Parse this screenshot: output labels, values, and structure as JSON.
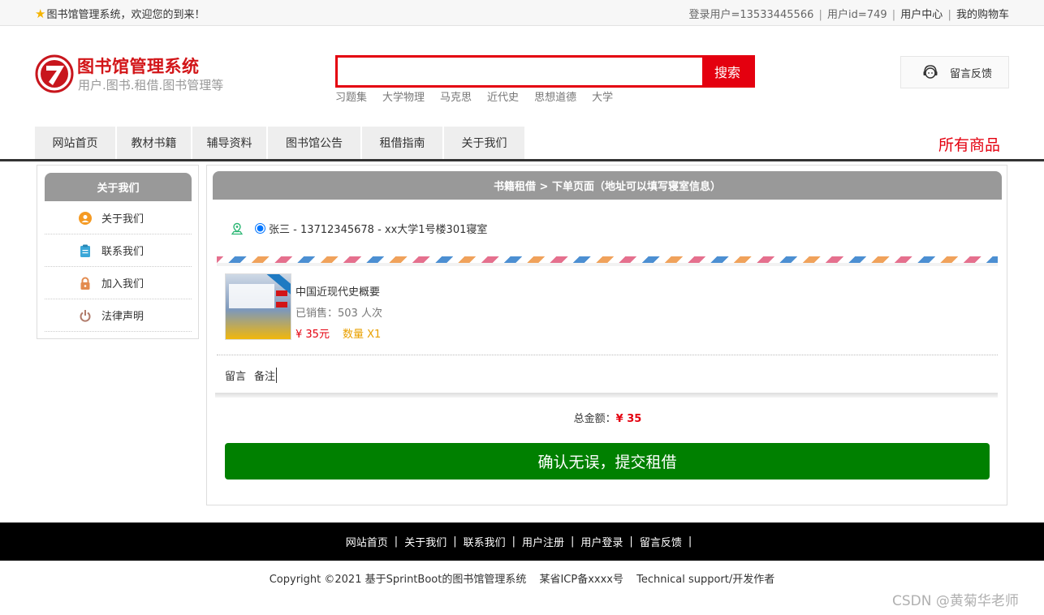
{
  "topbar": {
    "welcome": "图书馆管理系统，欢迎您的到来！",
    "login_user": "登录用户=13533445566",
    "user_id": "用户id=749",
    "user_center": "用户中心",
    "cart": "我的购物车"
  },
  "header": {
    "title": "图书馆管理系统",
    "subtitle": "用户.图书.租借.图书管理等",
    "search_button": "搜索",
    "search_value": "",
    "hot_words": [
      "习题集",
      "大学物理",
      "马克思",
      "近代史",
      "思想道德",
      "大学"
    ],
    "feedback": "留言反馈"
  },
  "nav": {
    "items": [
      "网站首页",
      "教材书籍",
      "辅导资料",
      "图书馆公告",
      "租借指南",
      "关于我们"
    ],
    "all_goods": "所有商品"
  },
  "sidebar": {
    "title": "关于我们",
    "items": [
      {
        "label": "关于我们",
        "icon": "user-circle-icon",
        "color": "#f59a23"
      },
      {
        "label": "联系我们",
        "icon": "clipboard-icon",
        "color": "#3aa7d8"
      },
      {
        "label": "加入我们",
        "icon": "lock-icon",
        "color": "#e38b4f"
      },
      {
        "label": "法律声明",
        "icon": "power-icon",
        "color": "#b07a6a"
      }
    ]
  },
  "order": {
    "breadcrumb": "书籍租借 > 下单页面（地址可以填写寝室信息）",
    "address": "张三 - 13712345678 - xx大学1号楼301寝室",
    "product_name": "中国近现代史概要",
    "sold": "已销售：503 人次",
    "price": "¥ 35元",
    "quantity": "数量 X1",
    "note_label": "留言",
    "note_value": "备注",
    "total_label": "总金额：",
    "total_value": "¥ 35",
    "submit": "确认无误，提交租借"
  },
  "footer": {
    "links": [
      "网站首页",
      "关于我们",
      "联系我们",
      "用户注册",
      "用户登录",
      "留言反馈"
    ],
    "separator": "|",
    "copyright": "Copyright ©2021 基于SprintBoot的图书馆管理系统",
    "icp": "某省ICP备xxxx号",
    "support": "Technical support/开发作者",
    "watermark": "CSDN @黄菊华老师"
  },
  "colors": {
    "accent": "#e4000f",
    "submit": "#008000",
    "panel_head": "#999999"
  }
}
